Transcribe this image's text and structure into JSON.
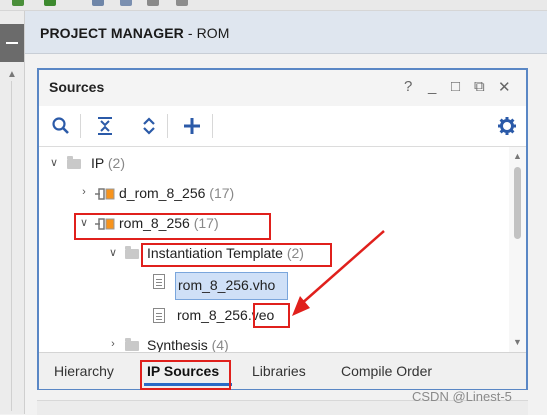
{
  "header": {
    "title_bold": "PROJECT MANAGER",
    "title_rest": " - ROM"
  },
  "panel": {
    "title": "Sources",
    "window_controls": [
      "?",
      "_",
      "□",
      "⧉",
      "✕"
    ],
    "toolbar_icons": [
      "search-icon",
      "collapse-all-icon",
      "expand-icon",
      "add-icon",
      "gear-icon"
    ]
  },
  "tree": {
    "ip": {
      "label": "IP",
      "count": "(2)"
    },
    "d_rom": {
      "label": "d_rom_8_256",
      "count": "(17)"
    },
    "rom": {
      "label": "rom_8_256",
      "count": "(17)"
    },
    "inst": {
      "label": "Instantiation Template",
      "count": "(2)"
    },
    "vho": {
      "label": "rom_8_256.vho"
    },
    "veo_a": {
      "label": "rom_8_256"
    },
    "veo_b": {
      "label": ".veo"
    },
    "synth": {
      "label": "Synthesis",
      "count": "(4)"
    }
  },
  "tabs": [
    "Hierarchy",
    "IP Sources",
    "Libraries",
    "Compile Order"
  ],
  "watermark": "CSDN @Linest-5",
  "colors": {
    "accent": "#2b6bc7",
    "annotation": "#e0201c",
    "panel_border": "#5a87c5"
  }
}
